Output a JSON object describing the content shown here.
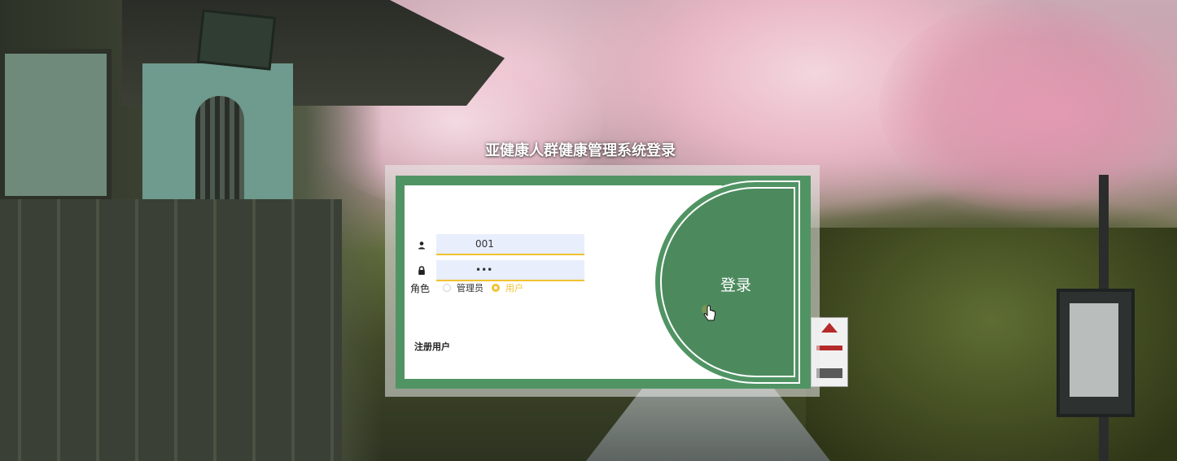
{
  "page": {
    "title": "亚健康人群健康管理系统登录"
  },
  "form": {
    "username": {
      "value": "001",
      "icon": "user-icon"
    },
    "password": {
      "value": "•••",
      "icon": "lock-icon"
    },
    "role": {
      "label": "角色",
      "options": [
        {
          "label": "管理员",
          "checked": false
        },
        {
          "label": "用户",
          "checked": true
        }
      ]
    },
    "register_label": "注册用户",
    "login_label": "登录"
  },
  "colors": {
    "frame_green": "#519464",
    "accent_yellow": "#f1c232",
    "input_bg": "#e8eefc"
  }
}
